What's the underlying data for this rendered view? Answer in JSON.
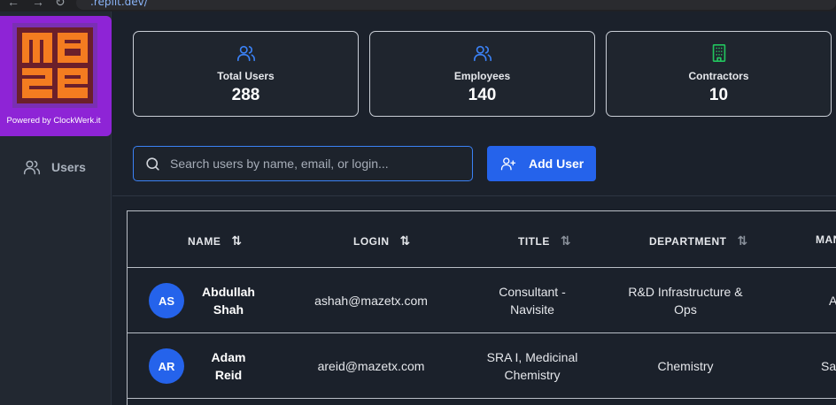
{
  "browser": {
    "url": ".replit.dev/"
  },
  "brand": {
    "logo_text": "maze",
    "powered_by": "Powered by ClockWerk.it"
  },
  "sidebar": {
    "items": [
      {
        "label": "Users",
        "icon": "users-icon"
      }
    ]
  },
  "stats": [
    {
      "label": "Total Users",
      "value": "288",
      "icon": "users-icon",
      "color": "#3b82f6"
    },
    {
      "label": "Employees",
      "value": "140",
      "icon": "users-icon",
      "color": "#3b82f6"
    },
    {
      "label": "Contractors",
      "value": "10",
      "icon": "building-icon",
      "color": "#22c55e"
    }
  ],
  "search": {
    "placeholder": "Search users by name, email, or login..."
  },
  "toolbar": {
    "add_user_label": "Add User"
  },
  "table": {
    "columns": [
      {
        "label": "NAME",
        "sortable": true
      },
      {
        "label": "LOGIN",
        "sortable": true
      },
      {
        "label": "TITLE",
        "sortable": true
      },
      {
        "label": "DEPARTMENT",
        "sortable": true
      },
      {
        "label": "MAN",
        "sortable": true
      }
    ],
    "rows": [
      {
        "initials": "AS",
        "first": "Abdullah",
        "last": "Shah",
        "login": "ashah@mazetx.com",
        "title1": "Consultant -",
        "title2": "Navisite",
        "dept1": "R&D Infrastructure &",
        "dept2": "Ops",
        "manager": "A"
      },
      {
        "initials": "AR",
        "first": "Adam",
        "last": "Reid",
        "login": "areid@mazetx.com",
        "title1": "SRA I, Medicinal",
        "title2": "Chemistry",
        "dept1": "Chemistry",
        "dept2": "",
        "manager": "Sar"
      }
    ]
  },
  "colors": {
    "accent": "#2563eb",
    "sidebar_brand": "#8e24d6",
    "contractor_icon": "#22c55e"
  }
}
